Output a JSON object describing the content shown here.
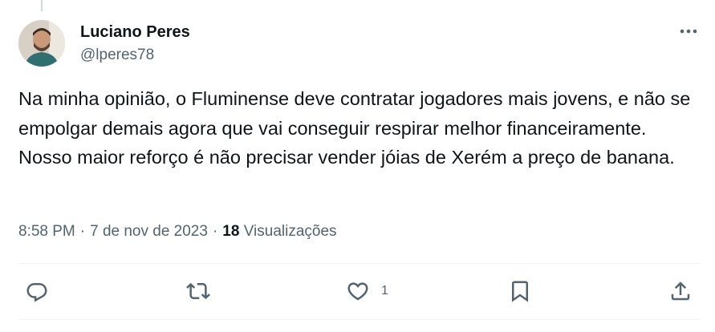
{
  "user": {
    "display_name": "Luciano Peres",
    "handle": "@lperes78"
  },
  "tweet": {
    "text": "Na minha opinião, o Fluminense deve contratar jogadores mais jovens, e não se empolgar demais agora que vai conseguir respirar melhor financeiramente. Nosso maior reforço é não precisar vender jóias de Xerém a preço de banana.",
    "time": "8:58 PM",
    "separator": "·",
    "date": "7 de nov de 2023",
    "views_count": "18",
    "views_label": "Visualizações"
  },
  "actions": {
    "like_count": "1"
  },
  "icons": {
    "more": "more-horizontal-icon",
    "reply": "reply-icon",
    "retweet": "retweet-icon",
    "like": "heart-icon",
    "bookmark": "bookmark-icon",
    "share": "share-icon"
  },
  "colors": {
    "text_primary": "#0f1419",
    "text_secondary": "#536471",
    "divider": "#eff3f4"
  }
}
